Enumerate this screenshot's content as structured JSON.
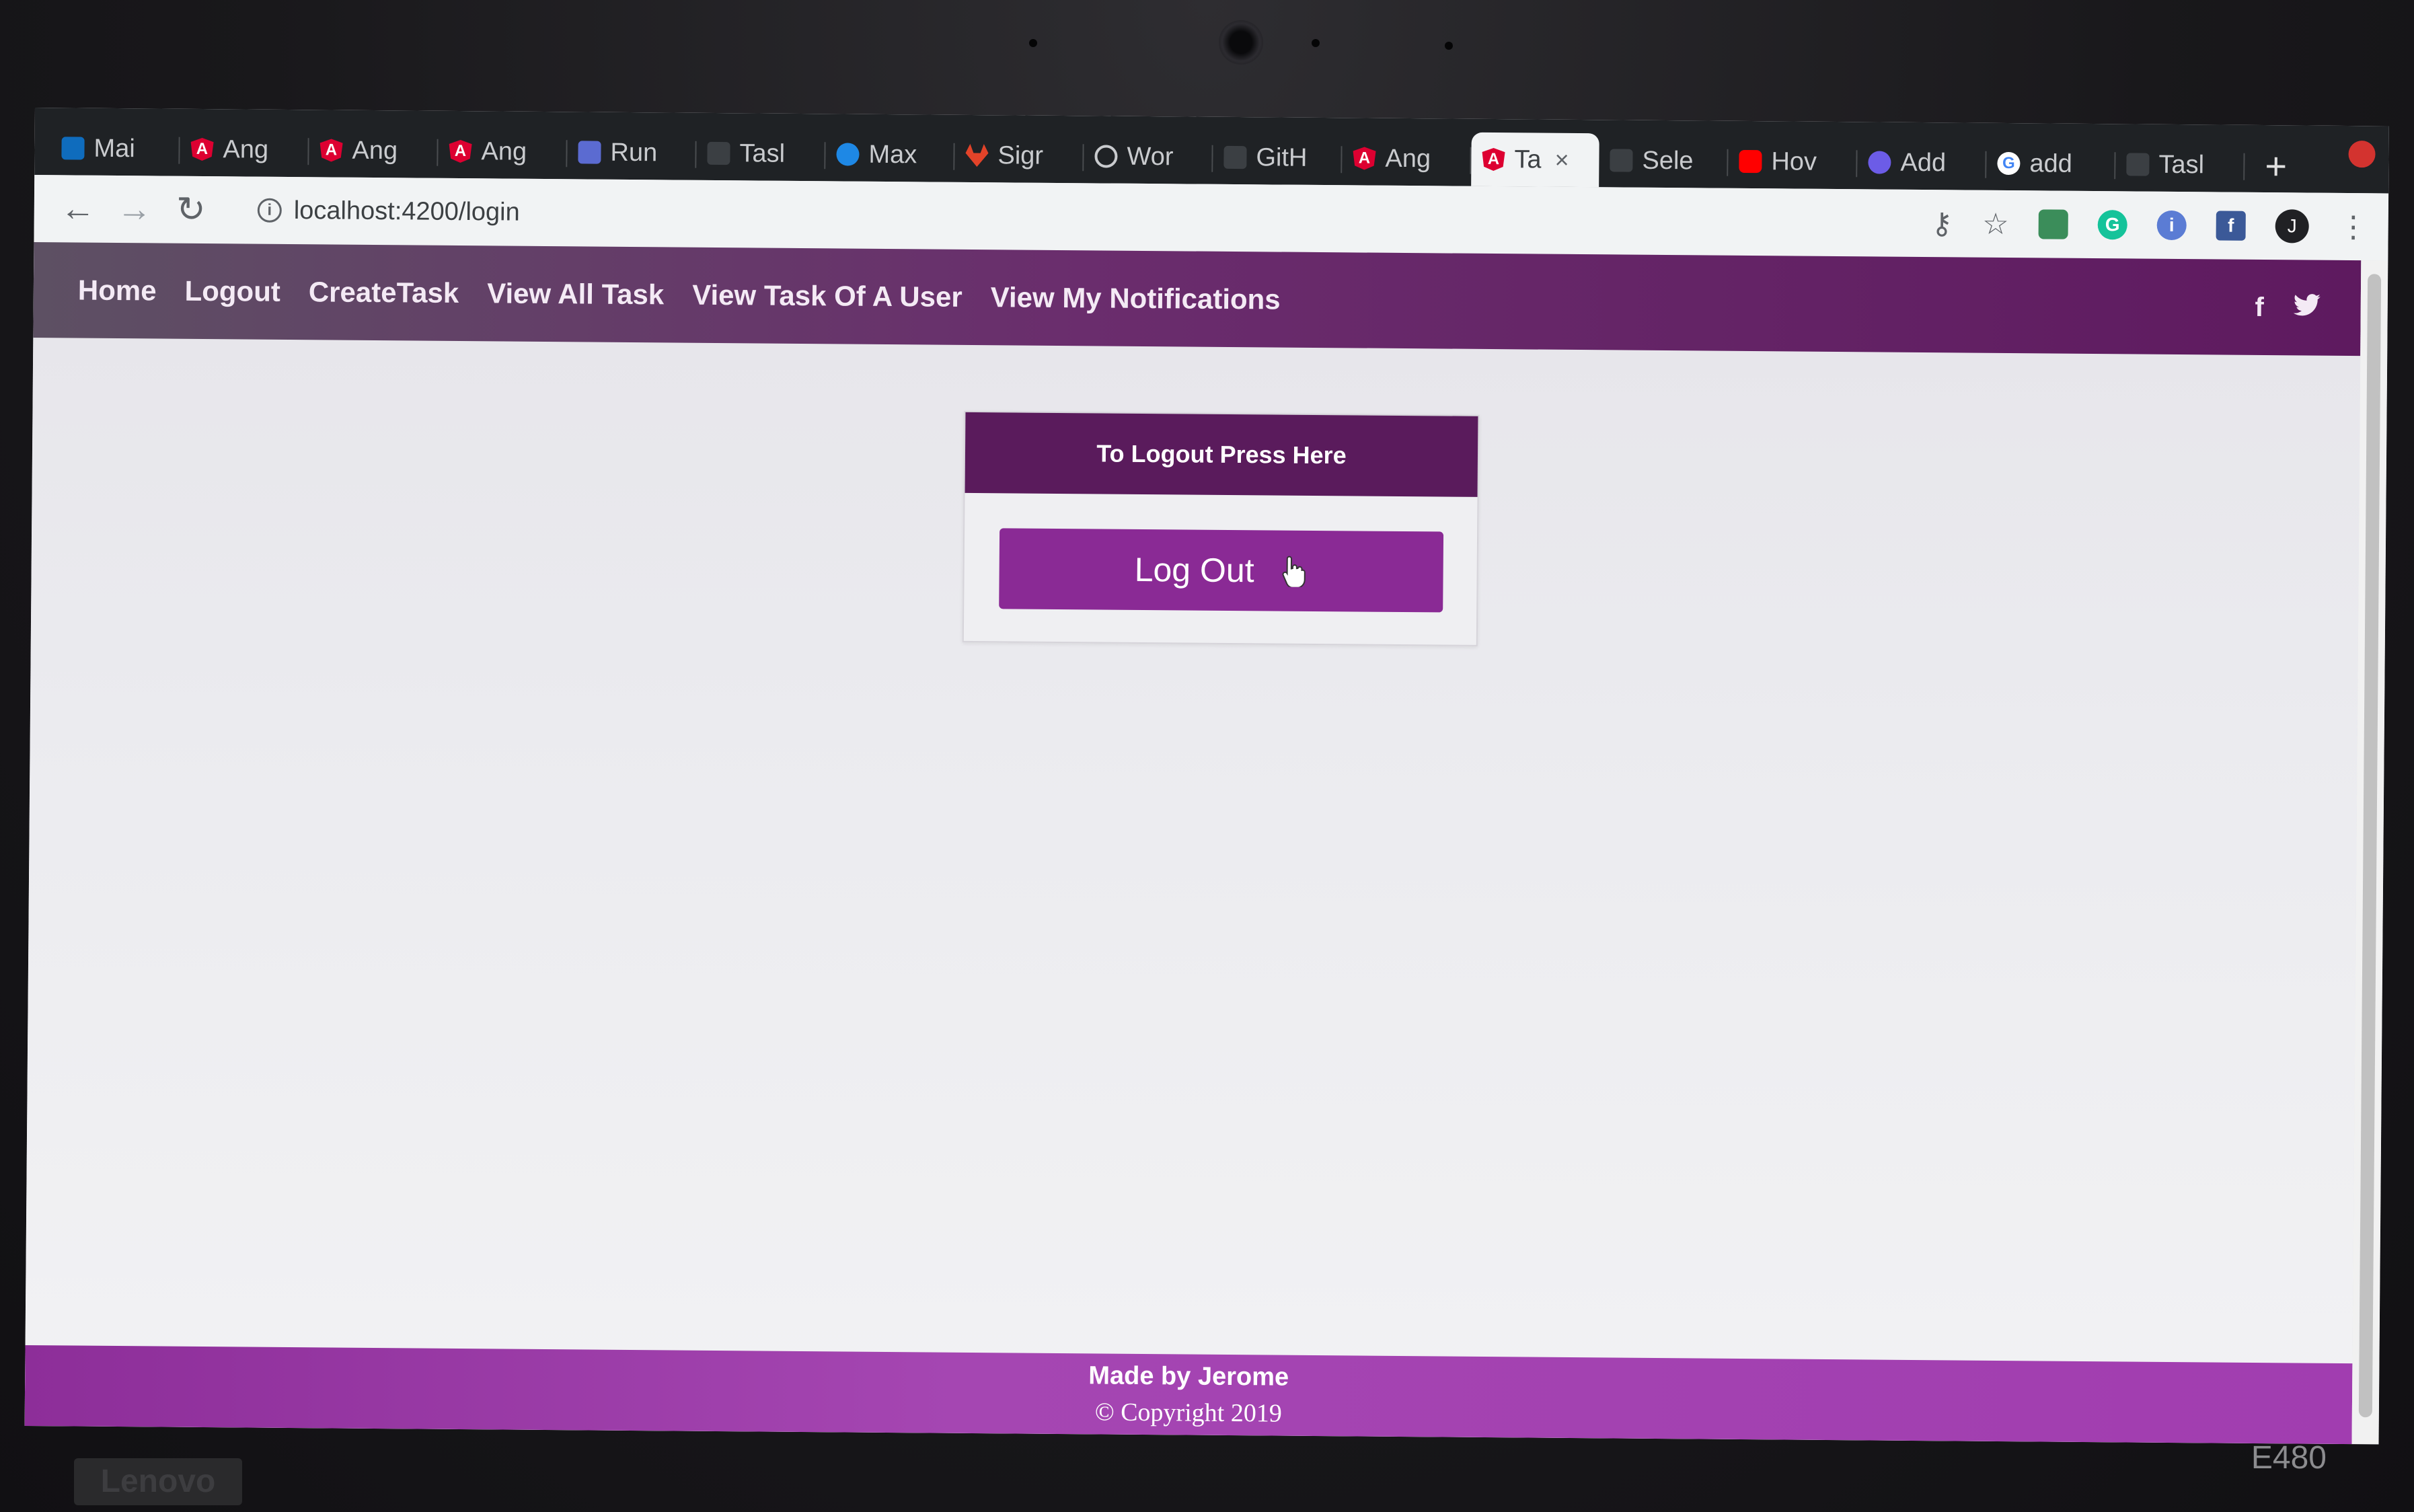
{
  "browser": {
    "tabs": [
      {
        "label": "Mai",
        "icon": "outlook-icon"
      },
      {
        "label": "Ang",
        "icon": "angular-icon"
      },
      {
        "label": "Ang",
        "icon": "angular-icon"
      },
      {
        "label": "Ang",
        "icon": "angular-icon"
      },
      {
        "label": "Run",
        "icon": "run-icon"
      },
      {
        "label": "Tasl",
        "icon": "blank-icon"
      },
      {
        "label": "Max",
        "icon": "salesforce-icon"
      },
      {
        "label": "Sigr",
        "icon": "gitlab-icon"
      },
      {
        "label": "Wor",
        "icon": "wordpress-icon"
      },
      {
        "label": "GitH",
        "icon": "github-icon"
      },
      {
        "label": "Ang",
        "icon": "angular-icon"
      },
      {
        "label": "Ta",
        "icon": "angular-icon",
        "active": true,
        "close": "×"
      },
      {
        "label": "Sele",
        "icon": "blank-icon"
      },
      {
        "label": "Hov",
        "icon": "youtube-icon"
      },
      {
        "label": "Add",
        "icon": "addon-icon"
      },
      {
        "label": "add",
        "icon": "google-icon"
      },
      {
        "label": "Tasl",
        "icon": "blank-icon"
      }
    ],
    "new_tab": "+",
    "url": "localhost:4200/login",
    "avatar_initial": "J"
  },
  "nav": {
    "home": "Home",
    "logout": "Logout",
    "create_task": "CreateTask",
    "view_all_task": "View All Task",
    "view_task_of_user": "View Task Of A User",
    "view_notifications": "View My Notifications",
    "social": {
      "facebook": "f",
      "twitter": "twitter-icon"
    }
  },
  "logout_card": {
    "header": "To Logout Press Here",
    "button_label": "Log Out"
  },
  "footer": {
    "made_by": "Made by Jerome",
    "copyright": "© Copyright 2019"
  },
  "device": {
    "brand": "Lenovo",
    "model": "E480"
  },
  "colors": {
    "navbar": "#6a2d6d",
    "card_header": "#5a1b5c",
    "logout_button": "#8a2a95",
    "footer": "#a546b2"
  }
}
